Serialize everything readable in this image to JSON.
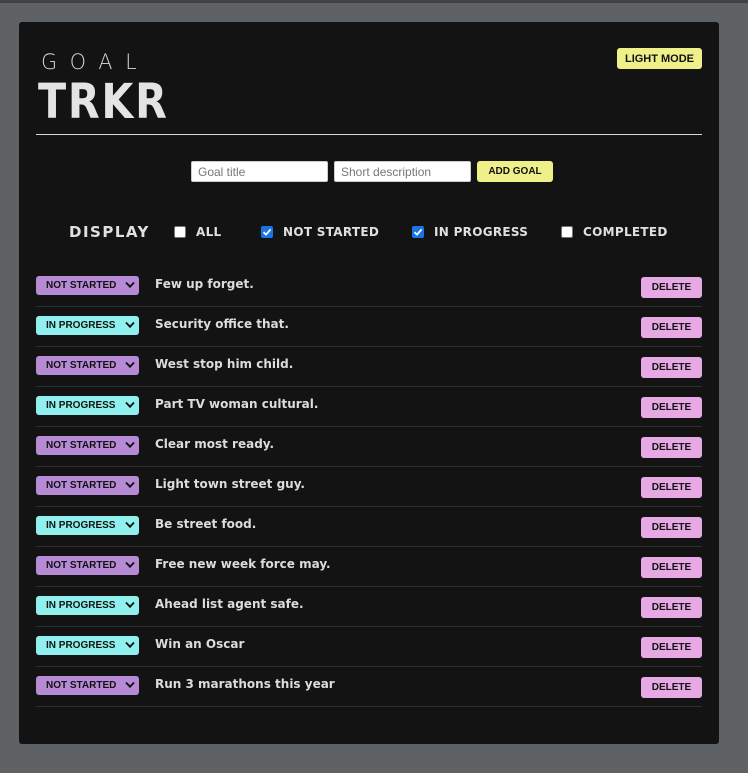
{
  "header": {
    "logo_top": "GOAL",
    "logo_bottom": "TRKR",
    "mode_button": "LIGHT MODE"
  },
  "form": {
    "title_placeholder": "Goal title",
    "description_placeholder": "Short description",
    "add_button": "ADD GOAL"
  },
  "filters": {
    "label": "DISPLAY",
    "options": [
      {
        "label": "ALL",
        "checked": false
      },
      {
        "label": "NOT STARTED",
        "checked": true
      },
      {
        "label": "IN PROGRESS",
        "checked": true
      },
      {
        "label": "COMPLETED",
        "checked": false
      }
    ]
  },
  "colors": {
    "not_started": "#b78ad6",
    "in_progress": "#8ff0ee",
    "delete": "#e7a9e3",
    "accent": "#f0f08a"
  },
  "goals": [
    {
      "status": "NOT STARTED",
      "title": "Few up forget.",
      "delete": "DELETE"
    },
    {
      "status": "IN PROGRESS",
      "title": "Security office that.",
      "delete": "DELETE"
    },
    {
      "status": "NOT STARTED",
      "title": "West stop him child.",
      "delete": "DELETE"
    },
    {
      "status": "IN PROGRESS",
      "title": "Part TV woman cultural.",
      "delete": "DELETE"
    },
    {
      "status": "NOT STARTED",
      "title": "Clear most ready.",
      "delete": "DELETE"
    },
    {
      "status": "NOT STARTED",
      "title": "Light town street guy.",
      "delete": "DELETE"
    },
    {
      "status": "IN PROGRESS",
      "title": "Be street food.",
      "delete": "DELETE"
    },
    {
      "status": "NOT STARTED",
      "title": "Free new week force may.",
      "delete": "DELETE"
    },
    {
      "status": "IN PROGRESS",
      "title": "Ahead list agent safe.",
      "delete": "DELETE"
    },
    {
      "status": "IN PROGRESS",
      "title": "Win an Oscar",
      "delete": "DELETE"
    },
    {
      "status": "NOT STARTED",
      "title": "Run 3 marathons this year",
      "delete": "DELETE"
    }
  ]
}
